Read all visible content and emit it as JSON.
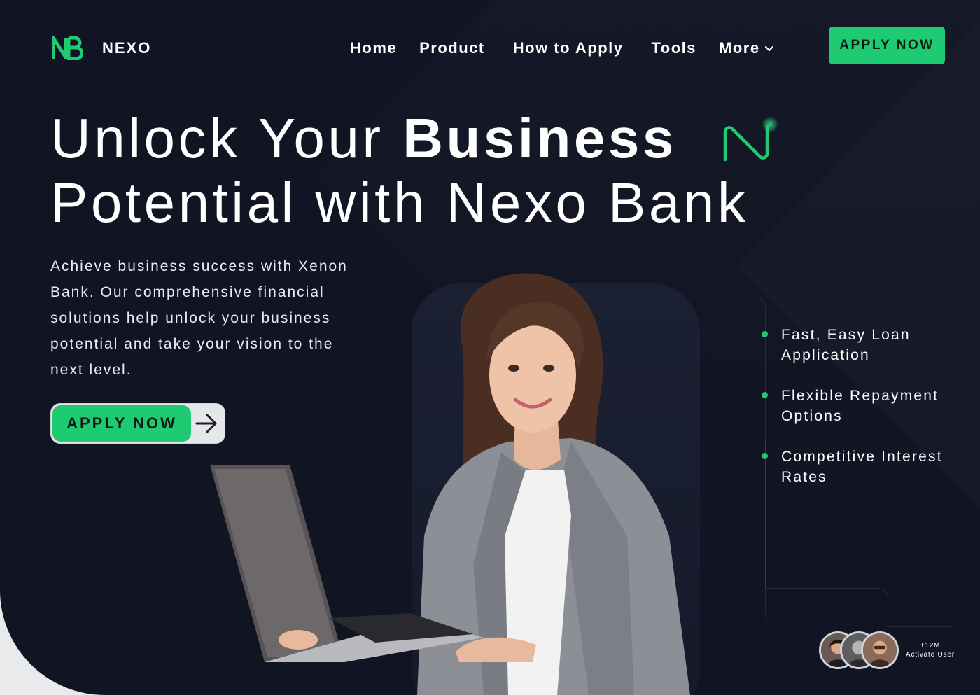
{
  "brand": {
    "mark": "NB",
    "name": "NEXO",
    "accent_color": "#1fcb72",
    "background_color": "#111423"
  },
  "nav": {
    "items": [
      "Home",
      "Product",
      "How to Apply",
      "Tools"
    ],
    "more_label": "More",
    "cta_label": "APPLY NOW"
  },
  "hero": {
    "headline_part1": "Unlock Your ",
    "headline_bold": "Business",
    "headline_line2": "Potential with Nexo Bank",
    "description": "Achieve business success with Xenon Bank. Our comprehensive financial solutions help unlock your business potential and take your vision to the next level.",
    "cta_label": "APPLY NOW"
  },
  "features": [
    "Fast, Easy Loan Application",
    "Flexible Repayment Options",
    "Competitive Interest Rates"
  ],
  "users": {
    "count": "+12M",
    "label": "Activate User"
  },
  "icons": [
    "logo-mark-icon",
    "chevron-down-icon",
    "n-accent-icon",
    "arrow-right-icon",
    "bullet-dot-icon",
    "avatar-icon"
  ]
}
